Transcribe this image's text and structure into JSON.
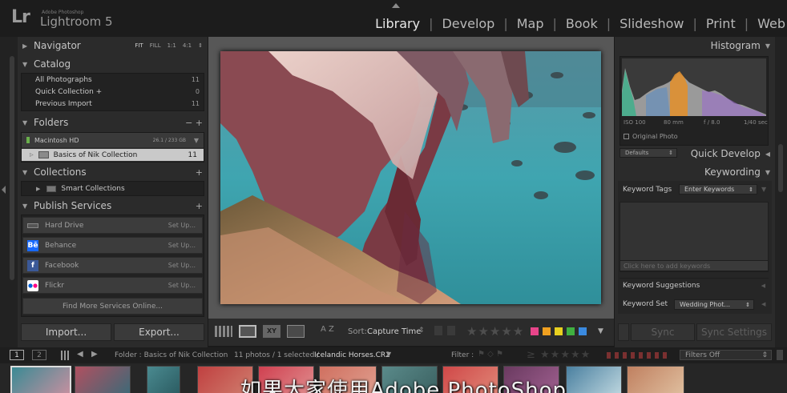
{
  "app": {
    "logo": "Lr",
    "subtitle": "Adobe Photoshop",
    "name": "Lightroom 5"
  },
  "modules": [
    "Library",
    "Develop",
    "Map",
    "Book",
    "Slideshow",
    "Print",
    "Web"
  ],
  "active_module": "Library",
  "left": {
    "navigator": {
      "title": "Navigator",
      "zoom_options": [
        "FIT",
        "FILL",
        "1:1",
        "4:1"
      ]
    },
    "catalog": {
      "title": "Catalog",
      "items": [
        {
          "label": "All Photographs",
          "count": "11"
        },
        {
          "label": "Quick Collection +",
          "count": "0"
        },
        {
          "label": "Previous Import",
          "count": "11"
        }
      ]
    },
    "folders": {
      "title": "Folders",
      "controls": "−  +",
      "volume": {
        "label": "Macintosh HD",
        "size": "26.1 / 233 GB"
      },
      "folder": {
        "label": "Basics of Nik Collection",
        "count": "11"
      }
    },
    "collections": {
      "title": "Collections",
      "plus": "+",
      "item": "Smart Collections"
    },
    "publish": {
      "title": "Publish Services",
      "plus": "+",
      "services": [
        {
          "label": "Hard Drive",
          "icon": "hard-drive-icon",
          "setup": "Set Up..."
        },
        {
          "label": "Behance",
          "icon": "behance-icon",
          "icon_text": "Bē",
          "setup": "Set Up..."
        },
        {
          "label": "Facebook",
          "icon": "facebook-icon",
          "icon_text": "f",
          "setup": "Set Up..."
        },
        {
          "label": "Flickr",
          "icon": "flickr-icon",
          "setup": "Set Up..."
        }
      ],
      "find_more": "Find More Services Online..."
    },
    "import_label": "Import...",
    "export_label": "Export..."
  },
  "toolbar": {
    "sort_label": "Sort:",
    "sort_value": "Capture Time",
    "sort_icon_text": "A Z",
    "flag_colors": [
      "#e8458a",
      "#f0a020",
      "#e8d020",
      "#40b040",
      "#3a8ae0"
    ]
  },
  "right": {
    "histogram": {
      "title": "Histogram",
      "iso": "ISO 100",
      "focal": "80 mm",
      "aperture": "f / 8.0",
      "shutter": "1/40 sec",
      "original_photo": "Original Photo"
    },
    "quick_develop": {
      "title": "Quick Develop",
      "preset": "Defaults"
    },
    "keywording": {
      "title": "Keywording",
      "tags_label": "Keyword Tags",
      "tags_value": "Enter Keywords",
      "add_placeholder": "Click here to add keywords",
      "suggestions": "Keyword Suggestions",
      "set_label": "Keyword Set",
      "set_value": "Wedding Phot..."
    },
    "sync_label": "Sync",
    "sync_settings_label": "Sync Settings"
  },
  "filmstrip": {
    "page1": "1",
    "page2": "2",
    "path": "Folder : Basics of Nik Collection",
    "count_text": "11 photos / 1 selected /",
    "selected_file": "Icelandic Horses.CR2",
    "filter_label": "Filter :",
    "filter_value": "Filters Off"
  },
  "overlay_subtitle": "如果大家使用Adobe PhotoShop"
}
